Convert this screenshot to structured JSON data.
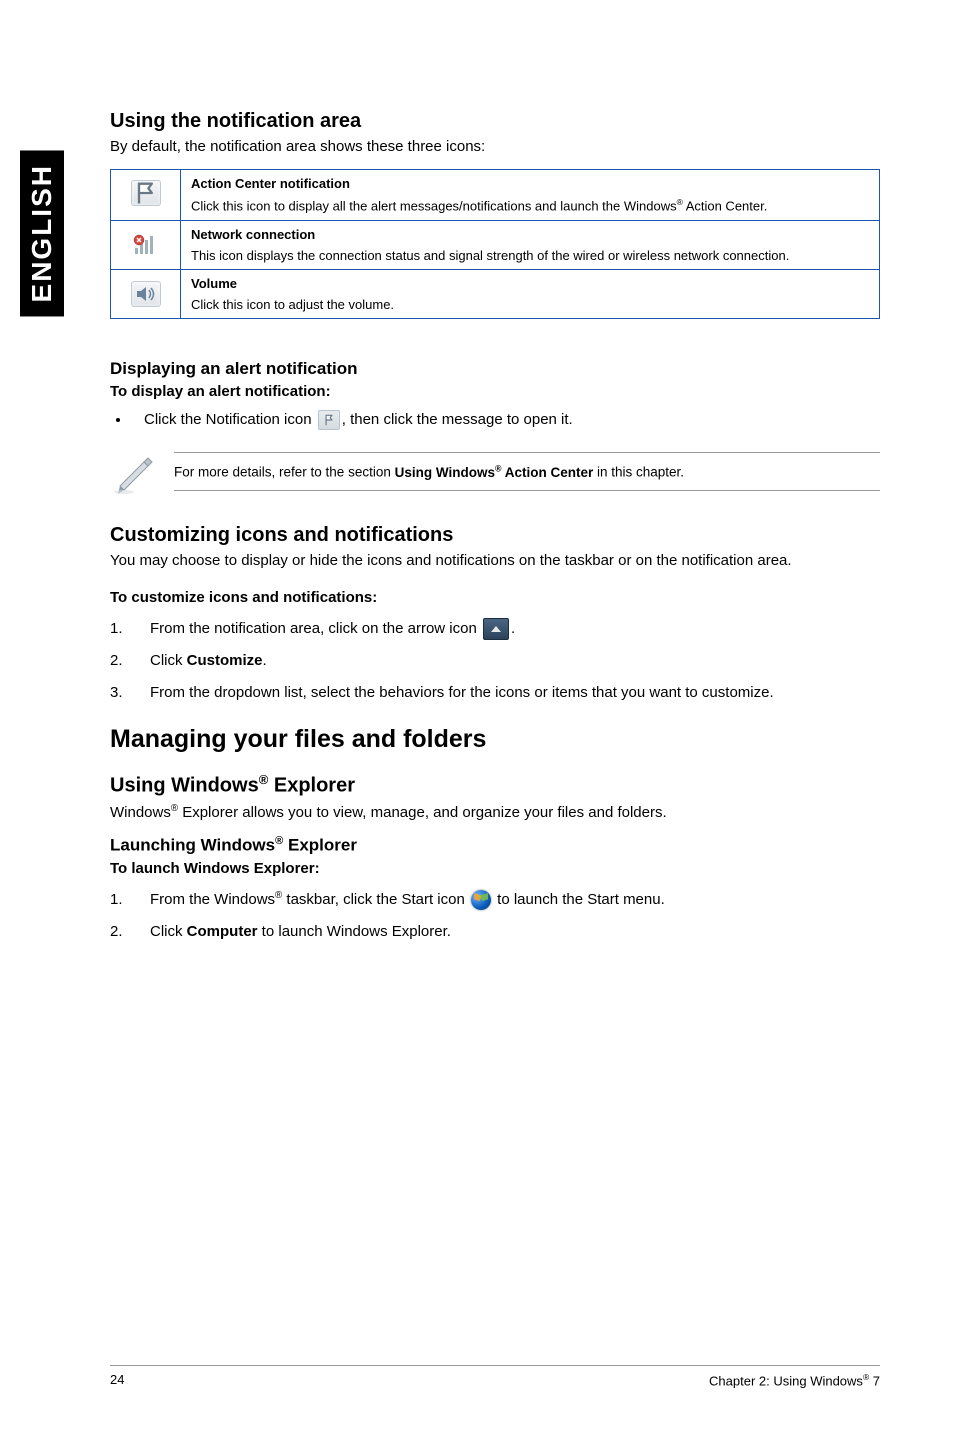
{
  "sidebar_label": "ENGLISH",
  "section1": {
    "heading": "Using the notification area",
    "intro": "By default, the notification area shows these three icons:"
  },
  "table": {
    "rows": [
      {
        "icon": "action-center-flag",
        "title": "Action Center notification",
        "desc_pre": "Click this icon to display all the alert messages/notifications and launch the Windows",
        "desc_post": " Action Center."
      },
      {
        "icon": "network",
        "title": "Network connection",
        "desc": "This icon displays the connection status and signal strength of the wired or wireless network connection."
      },
      {
        "icon": "volume",
        "title": "Volume",
        "desc": "Click this icon to adjust the volume."
      }
    ]
  },
  "alert": {
    "heading": "Displaying an alert notification",
    "subheading": "To display an alert notification:",
    "bullet_pre": "Click the Notification icon ",
    "bullet_post": ", then click the message to open it."
  },
  "note": {
    "pre": "For more details, refer to the section ",
    "bold_a": "Using Windows",
    "bold_b": " Action Center",
    "post": " in this chapter."
  },
  "customize": {
    "heading": "Customizing icons and notifications",
    "intro": "You may choose to display or hide the icons and notifications on the taskbar or on the notification area.",
    "subheading": "To customize icons and notifications:",
    "steps": [
      {
        "num": "1.",
        "text_pre": "From the notification area, click on the arrow icon ",
        "has_arrow": true,
        "text_post": "."
      },
      {
        "num": "2.",
        "text_pre": "Click ",
        "bold": "Customize",
        "text_post": "."
      },
      {
        "num": "3.",
        "text": "From the dropdown list, select the behaviors for the icons or items that you want to customize."
      }
    ]
  },
  "major_heading": "Managing your files and folders",
  "explorer": {
    "heading_pre": "Using Windows",
    "heading_post": " Explorer",
    "intro_pre": "Windows",
    "intro_post": " Explorer allows you to view, manage, and organize your files and folders.",
    "sub_pre": "Launching Windows",
    "sub_post": " Explorer",
    "subbold": "To launch Windows Explorer:",
    "steps": [
      {
        "num": "1.",
        "pre": "From the Windows",
        "mid": " taskbar, click the Start icon ",
        "post": " to launch the Start menu."
      },
      {
        "num": "2.",
        "pre": "Click ",
        "bold": "Computer",
        "post": " to launch Windows Explorer."
      }
    ]
  },
  "footer": {
    "page": "24",
    "chapter_pre": "Chapter 2: Using Windows",
    "chapter_post": " 7"
  }
}
